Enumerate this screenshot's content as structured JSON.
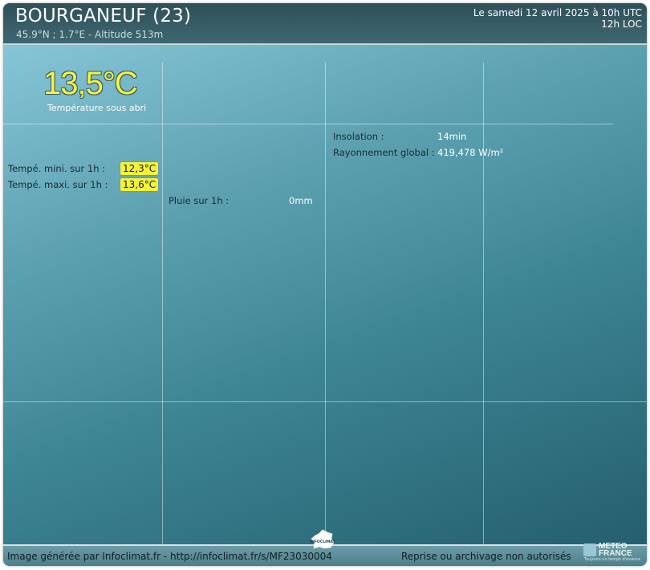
{
  "station": {
    "name": "BOURGANEUF (23)",
    "coords": "45.9°N ; 1.7°E - Altitude 513m"
  },
  "datetime": {
    "utc": "Le samedi 12 avril 2025 à 10h UTC",
    "local": "12h LOC"
  },
  "temperature": {
    "value": "13,5°C",
    "label": "Température sous abri"
  },
  "min_max": {
    "min_label": "Tempé. mini. sur 1h :",
    "min_value": "12,3°C",
    "max_label": "Tempé. maxi. sur 1h :",
    "max_value": "13,6°C"
  },
  "rain": {
    "label": "Pluie sur 1h :",
    "value": "0mm"
  },
  "sun": {
    "insolation_label": "Insolation :",
    "insolation_value": "14min",
    "radiation_label": "Rayonnement global :",
    "radiation_value": "419,478 W/m²"
  },
  "footer": {
    "generated": "Image générée par Infoclimat.fr - http://infoclimat.fr/s/MF23030004",
    "rights": "Reprise ou archivage non autorisés",
    "infoclimat_icon_text": "INFOCLIMAT",
    "meteo_france_line1": "METEO",
    "meteo_france_line2": "FRANCE",
    "meteo_france_tagline": "Toujours un temps d'avance"
  },
  "colors": {
    "accent_yellow": "#f3f33a",
    "header_dark": "#2f5058",
    "panel_light": "#86c5d7",
    "panel_dark": "#245f6e"
  }
}
